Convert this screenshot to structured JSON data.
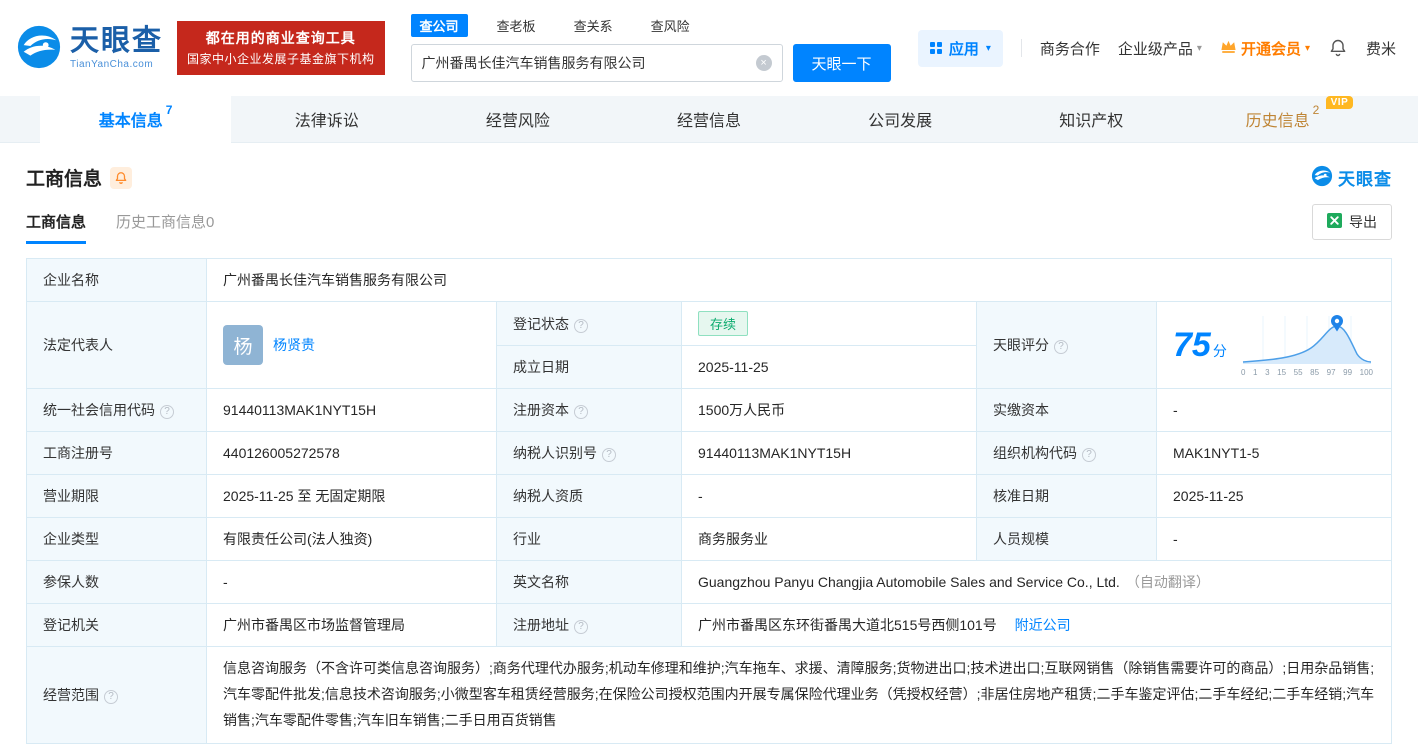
{
  "brand": {
    "name": "天眼查",
    "domain": "TianYanCha.com",
    "color": "#0084ff"
  },
  "header": {
    "slogan": {
      "line1": "都在用的商业查询工具",
      "line2": "国家中小企业发展子基金旗下机构"
    },
    "search": {
      "tabs": [
        {
          "label": "查公司"
        },
        {
          "label": "查老板"
        },
        {
          "label": "查关系"
        },
        {
          "label": "查风险"
        }
      ],
      "value": "广州番禺长佳汽车销售服务有限公司",
      "button": "天眼一下"
    },
    "nav": {
      "apps": "应用",
      "cooperation": "商务合作",
      "enterprise": "企业级产品",
      "vip": "开通会员",
      "user": "费米"
    }
  },
  "tabs": {
    "basic": {
      "label": "基本信息",
      "count": "7"
    },
    "legal": {
      "label": "法律诉讼"
    },
    "risk": {
      "label": "经营风险"
    },
    "operation": {
      "label": "经营信息"
    },
    "development": {
      "label": "公司发展"
    },
    "ip": {
      "label": "知识产权"
    },
    "history": {
      "label": "历史信息",
      "count": "2",
      "vip": "VIP"
    }
  },
  "section": {
    "title": "工商信息",
    "subtab_active": "工商信息",
    "subtab_history": "历史工商信息0",
    "export": "导出",
    "watermark": "天眼查"
  },
  "business_info": {
    "company_name": {
      "label": "企业名称",
      "value": "广州番禺长佳汽车销售服务有限公司"
    },
    "legal_rep": {
      "label": "法定代表人",
      "avatar": "杨",
      "name": "杨贤贵"
    },
    "reg_status": {
      "label": "登记状态",
      "value": "存续"
    },
    "establish_date": {
      "label": "成立日期",
      "value": "2025-11-25"
    },
    "score": {
      "label": "天眼评分",
      "value": "75",
      "unit": "分"
    },
    "credit_code": {
      "label": "统一社会信用代码",
      "value": "91440113MAK1NYT15H"
    },
    "reg_capital": {
      "label": "注册资本",
      "value": "1500万人民币"
    },
    "paid_capital": {
      "label": "实缴资本",
      "value": "-"
    },
    "reg_number": {
      "label": "工商注册号",
      "value": "440126005272578"
    },
    "taxpayer_id": {
      "label": "纳税人识别号",
      "value": "91440113MAK1NYT15H"
    },
    "org_code": {
      "label": "组织机构代码",
      "value": "MAK1NYT1-5"
    },
    "business_term": {
      "label": "营业期限",
      "value": "2025-11-25 至 无固定期限"
    },
    "taxpayer_quality": {
      "label": "纳税人资质",
      "value": "-"
    },
    "approval_date": {
      "label": "核准日期",
      "value": "2025-11-25"
    },
    "company_type": {
      "label": "企业类型",
      "value": "有限责任公司(法人独资)"
    },
    "industry": {
      "label": "行业",
      "value": "商务服务业"
    },
    "staff_size": {
      "label": "人员规模",
      "value": "-"
    },
    "insured_count": {
      "label": "参保人数",
      "value": "-"
    },
    "english_name": {
      "label": "英文名称",
      "value": "Guangzhou Panyu Changjia Automobile Sales and Service Co., Ltd.",
      "note": "（自动翻译）"
    },
    "reg_authority": {
      "label": "登记机关",
      "value": "广州市番禺区市场监督管理局"
    },
    "reg_address": {
      "label": "注册地址",
      "value": "广州市番禺区东环街番禺大道北515号西侧101号",
      "link": "附近公司"
    },
    "business_scope": {
      "label": "经营范围",
      "value": "信息咨询服务（不含许可类信息咨询服务）;商务代理代办服务;机动车修理和维护;汽车拖车、求援、清障服务;货物进出口;技术进出口;互联网销售（除销售需要许可的商品）;日用杂品销售;汽车零配件批发;信息技术咨询服务;小微型客车租赁经营服务;在保险公司授权范围内开展专属保险代理业务（凭授权经营）;非居住房地产租赁;二手车鉴定评估;二手车经纪;二手车经销;汽车销售;汽车零配件零售;汽车旧车销售;二手日用百货销售"
    }
  },
  "chart_data": {
    "type": "area",
    "title": "天眼评分",
    "score": 75,
    "unit": "分",
    "x_ticks": [
      "0",
      "1",
      "3",
      "15",
      "55",
      "85",
      "97",
      "99",
      "100"
    ]
  }
}
